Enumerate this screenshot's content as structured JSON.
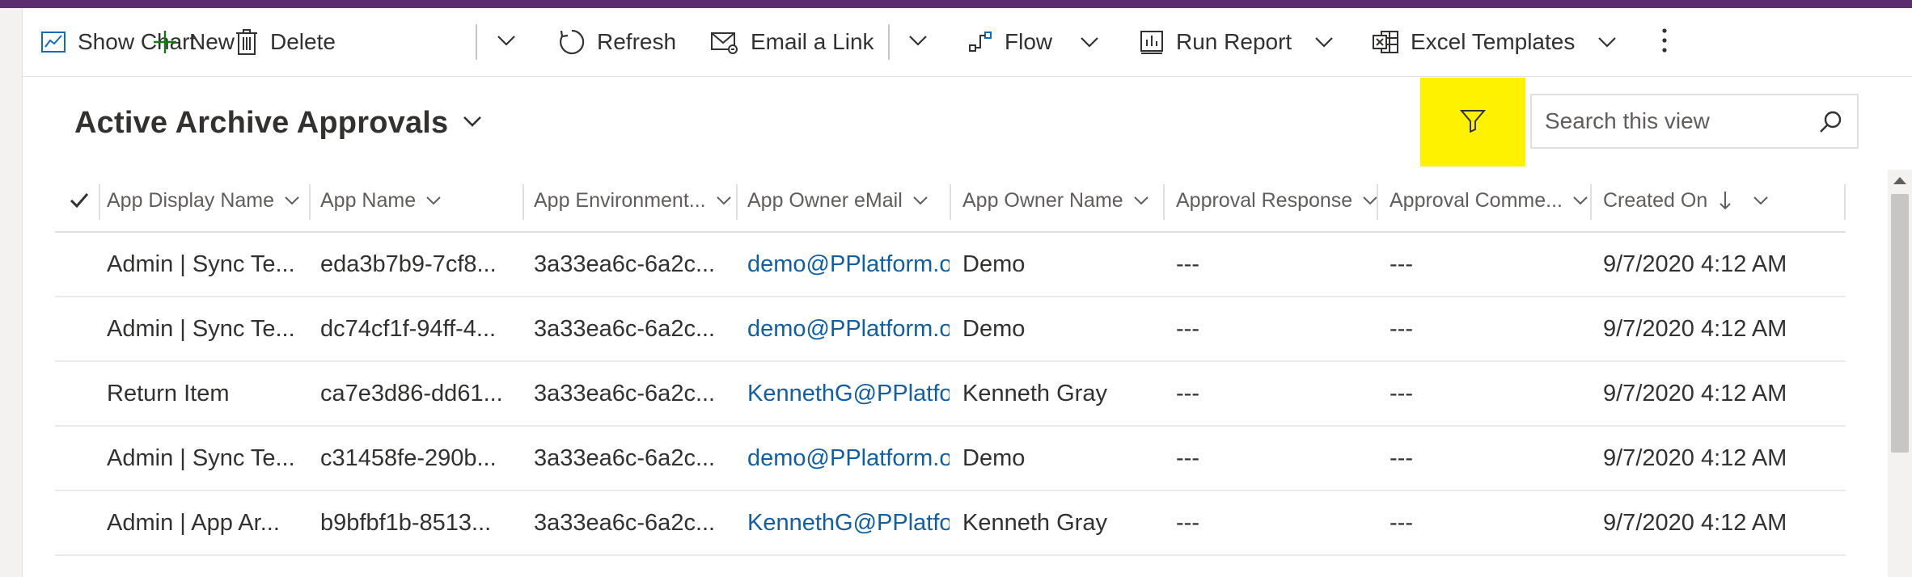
{
  "toolbar": {
    "show_chart": "Show Chart",
    "new": "New",
    "delete": "Delete",
    "refresh": "Refresh",
    "email_link": "Email a Link",
    "flow": "Flow",
    "run_report": "Run Report",
    "excel_templates": "Excel Templates"
  },
  "view": {
    "title": "Active Archive Approvals"
  },
  "search": {
    "placeholder": "Search this view"
  },
  "columns": [
    "App Display Name",
    "App Name",
    "App Environment...",
    "App Owner eMail",
    "App Owner Name",
    "Approval Response",
    "Approval Comme...",
    "Created On"
  ],
  "rows": [
    [
      "Admin | Sync Te...",
      "eda3b7b9-7cf8...",
      "3a33ea6c-6a2c...",
      "demo@PPlatform.or",
      "Demo",
      "---",
      "---",
      "9/7/2020 4:12 AM"
    ],
    [
      "Admin | Sync Te...",
      "dc74cf1f-94ff-4...",
      "3a33ea6c-6a2c...",
      "demo@PPlatform.or",
      "Demo",
      "---",
      "---",
      "9/7/2020 4:12 AM"
    ],
    [
      "Return Item",
      "ca7e3d86-dd61...",
      "3a33ea6c-6a2c...",
      "KennethG@PPlatfori",
      "Kenneth Gray",
      "---",
      "---",
      "9/7/2020 4:12 AM"
    ],
    [
      "Admin | Sync Te...",
      "c31458fe-290b...",
      "3a33ea6c-6a2c...",
      "demo@PPlatform.or",
      "Demo",
      "---",
      "---",
      "9/7/2020 4:12 AM"
    ],
    [
      "Admin | App Ar...",
      "b9bfbf1b-8513...",
      "3a33ea6c-6a2c...",
      "KennethG@PPlatfori",
      "Kenneth Gray",
      "---",
      "---",
      "9/7/2020 4:12 AM"
    ]
  ],
  "colors": {
    "top_bar": "#5c2d6e",
    "filter_highlight": "#fef200",
    "link": "#115ea3"
  }
}
